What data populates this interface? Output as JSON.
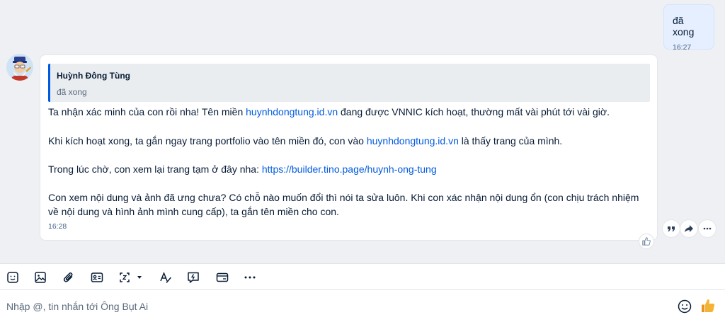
{
  "colors": {
    "accent": "#005ae0",
    "chat_bg": "#eef0f4",
    "sent_bubble": "#e5efff",
    "received_bubble": "#ffffff",
    "quote_bg": "#eaedf0",
    "text": "#081c36",
    "muted": "#476285",
    "thumb": "#f5a623"
  },
  "sent_message": {
    "text": "đã xong",
    "time": "16:27"
  },
  "received_message": {
    "avatar_icon": "cartoon-avatar-icon",
    "quote": {
      "author": "Huỳnh Đông Tùng",
      "text": "đã xong"
    },
    "p1": {
      "before": "Ta nhận xác minh của con rồi nha! Tên miền ",
      "link": "huynhdongtung.id.vn",
      "after": " đang được VNNIC kích hoạt, thường mất vài phút tới vài giờ."
    },
    "p2": {
      "before": "Khi kích hoạt xong, ta gắn ngay trang portfolio vào tên miền đó, con vào ",
      "link": "huynhdongtung.id.vn",
      "after": " là thấy trang của mình."
    },
    "p3": {
      "before": "Trong lúc chờ, con xem lại trang tạm ở đây nha: ",
      "link": "https://builder.tino.page/huynh-ong-tung"
    },
    "p4": "Con xem nội dung và ảnh đã ưng chưa? Có chỗ nào muốn đổi thì nói ta sửa luôn. Khi con xác nhận nội dung ổn (con chịu trách nhiệm về nội dung và hình ảnh mình cung cấp), ta gắn tên miền cho con.",
    "time": "16:28"
  },
  "message_actions": [
    "quote-icon",
    "forward-icon",
    "more-icon"
  ],
  "toolbar_icons": [
    "sticker-icon",
    "image-icon",
    "attachment-icon",
    "contact-card-icon",
    "screenshot-icon",
    "text-format-icon",
    "quick-message-icon",
    "card-icon",
    "more-options-icon"
  ],
  "composer": {
    "placeholder": "Nhập @, tin nhắn tới Ông Bụt Ai"
  }
}
